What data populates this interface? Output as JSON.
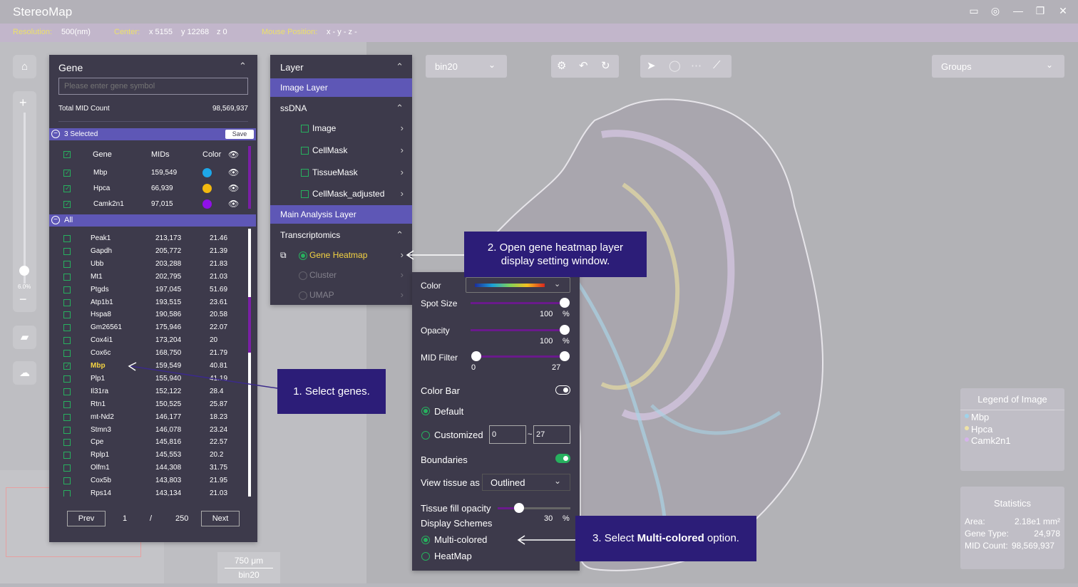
{
  "app": {
    "title": "StereoMap"
  },
  "infobar": {
    "resolution_label": "Resolution:",
    "resolution_value": "500(nm)",
    "center_label": "Center:",
    "center_x": "x 5155",
    "center_y": "y 12268",
    "center_z": "z 0",
    "mouse_label": "Mouse Position:",
    "mouse_value": "x -  y -  z -"
  },
  "gene_panel": {
    "title": "Gene",
    "search_placeholder": "Please enter gene symbol",
    "total_label": "Total MID Count",
    "total_value": "98,569,937",
    "selected_label": "3 Selected",
    "save_label": "Save",
    "headers": [
      "Gene",
      "MIDs",
      "Color"
    ],
    "selected": [
      {
        "gene": "Mbp",
        "mids": "159,549",
        "color": "#1ea7e8"
      },
      {
        "gene": "Hpca",
        "mids": "66,939",
        "color": "#f2b90f"
      },
      {
        "gene": "Camk2n1",
        "mids": "97,015",
        "color": "#8f10e8"
      }
    ],
    "all_label": "All",
    "genes": [
      {
        "gene": "Peak1",
        "mids": "213,173",
        "v": "21.46",
        "checked": false
      },
      {
        "gene": "Gapdh",
        "mids": "205,772",
        "v": "21.39",
        "checked": false
      },
      {
        "gene": "Ubb",
        "mids": "203,288",
        "v": "21.83",
        "checked": false
      },
      {
        "gene": "Mt1",
        "mids": "202,795",
        "v": "21.03",
        "checked": false
      },
      {
        "gene": "Ptgds",
        "mids": "197,045",
        "v": "51.69",
        "checked": false
      },
      {
        "gene": "Atp1b1",
        "mids": "193,515",
        "v": "23.61",
        "checked": false
      },
      {
        "gene": "Hspa8",
        "mids": "190,586",
        "v": "20.58",
        "checked": false
      },
      {
        "gene": "Gm26561",
        "mids": "175,946",
        "v": "22.07",
        "checked": false
      },
      {
        "gene": "Cox4i1",
        "mids": "173,204",
        "v": "20",
        "checked": false
      },
      {
        "gene": "Cox6c",
        "mids": "168,750",
        "v": "21.79",
        "checked": false
      },
      {
        "gene": "Mbp",
        "mids": "159,549",
        "v": "40.81",
        "checked": true
      },
      {
        "gene": "Plp1",
        "mids": "155,940",
        "v": "41.19",
        "checked": false
      },
      {
        "gene": "Il31ra",
        "mids": "152,122",
        "v": "28.4",
        "checked": false
      },
      {
        "gene": "Rtn1",
        "mids": "150,525",
        "v": "25.87",
        "checked": false
      },
      {
        "gene": "mt-Nd2",
        "mids": "146,177",
        "v": "18.23",
        "checked": false
      },
      {
        "gene": "Stmn3",
        "mids": "146,078",
        "v": "23.24",
        "checked": false
      },
      {
        "gene": "Cpe",
        "mids": "145,816",
        "v": "22.57",
        "checked": false
      },
      {
        "gene": "Rplp1",
        "mids": "145,553",
        "v": "20.2",
        "checked": false
      },
      {
        "gene": "Olfm1",
        "mids": "144,308",
        "v": "31.75",
        "checked": false
      },
      {
        "gene": "Cox5b",
        "mids": "143,803",
        "v": "21.95",
        "checked": false
      },
      {
        "gene": "Rps14",
        "mids": "143,134",
        "v": "21.03",
        "checked": false
      }
    ],
    "prev_label": "Prev",
    "page": "1",
    "page_sep": "/",
    "total_pages": "250",
    "next_label": "Next"
  },
  "layer_panel": {
    "title": "Layer",
    "image_layer": "Image Layer",
    "ssdna": "ssDNA",
    "items": [
      "Image",
      "CellMask",
      "TissueMask",
      "CellMask_adjusted"
    ],
    "main_layer": "Main Analysis Layer",
    "transcriptomics": "Transcriptomics",
    "gene_heatmap": "Gene Heatmap",
    "cluster": "Cluster",
    "umap": "UMAP"
  },
  "settings": {
    "color_label": "Color",
    "spot_label": "Spot Size",
    "spot_value": "100",
    "pct": "%",
    "opacity_label": "Opacity",
    "opacity_value": "100",
    "mid_label": "MID Filter",
    "mid_min": "0",
    "mid_max": "27",
    "colorbar_label": "Color Bar",
    "default_label": "Default",
    "customized_label": "Customized",
    "custom_min": "0",
    "custom_tilde": "~",
    "custom_max": "27",
    "boundaries_label": "Boundaries",
    "view_label": "View tissue as",
    "view_value": "Outlined",
    "fill_label": "Tissue fill opacity",
    "fill_value": "30",
    "schemes_label": "Display Schemes",
    "multi_label": "Multi-colored",
    "heatmap_label": "HeatMap"
  },
  "toolbar": {
    "bin_value": "bin20",
    "groups_value": "Groups"
  },
  "scale": {
    "length": "750 μm",
    "bin": "bin20"
  },
  "zoom": {
    "percent": "6.0%"
  },
  "legend": {
    "title": "Legend of Image",
    "items": [
      {
        "name": "Mbp",
        "color": "#9fd3ea"
      },
      {
        "name": "Hpca",
        "color": "#efe3a6"
      },
      {
        "name": "Camk2n1",
        "color": "#d6b3ec"
      }
    ]
  },
  "stats": {
    "title": "Statistics",
    "area_label": "Area:",
    "area_value": "2.18e1 mm²",
    "type_label": "Gene Type:",
    "type_value": "24,978",
    "mid_label": "MID Count:",
    "mid_value": "98,569,937"
  },
  "callouts": {
    "c1": "1. Select genes.",
    "c2_line1": "2. Open gene heatmap layer",
    "c2_line2": "display setting window.",
    "c3_pre": "3. Select ",
    "c3_bold": "Multi-colored",
    "c3_post": " option."
  }
}
